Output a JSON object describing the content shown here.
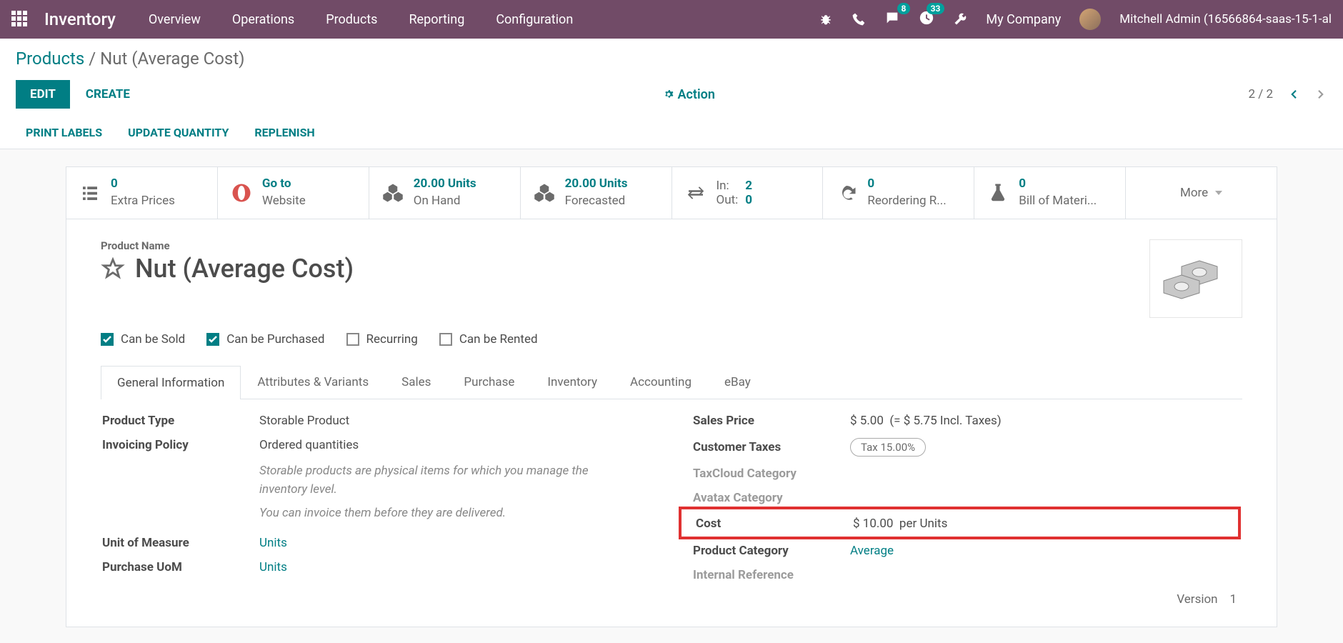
{
  "topnav": {
    "brand": "Inventory",
    "items": [
      "Overview",
      "Operations",
      "Products",
      "Reporting",
      "Configuration"
    ],
    "msg_badge": "8",
    "activity_badge": "33",
    "company": "My Company",
    "user": "Mitchell Admin (16566864-saas-15-1-al"
  },
  "breadcrumb": {
    "parent": "Products",
    "current": "Nut (Average Cost)"
  },
  "actions": {
    "edit": "EDIT",
    "create": "CREATE",
    "action": "Action",
    "pager": "2 / 2"
  },
  "subactions": [
    "PRINT LABELS",
    "UPDATE QUANTITY",
    "REPLENISH"
  ],
  "stats": {
    "extra_prices_n": "0",
    "extra_prices_l": "Extra Prices",
    "website_n": "Go to",
    "website_l": "Website",
    "onhand_n": "20.00 Units",
    "onhand_l": "On Hand",
    "forecast_n": "20.00 Units",
    "forecast_l": "Forecasted",
    "in_k": "In:",
    "in_v": "2",
    "out_k": "Out:",
    "out_v": "0",
    "reorder_n": "0",
    "reorder_l": "Reordering R...",
    "bom_n": "0",
    "bom_l": "Bill of Materi...",
    "more": "More"
  },
  "product": {
    "name_lbl": "Product Name",
    "name": "Nut (Average Cost)",
    "checks": {
      "sold": "Can be Sold",
      "purchased": "Can be Purchased",
      "recurring": "Recurring",
      "rented": "Can be Rented"
    }
  },
  "tabs": [
    "General Information",
    "Attributes & Variants",
    "Sales",
    "Purchase",
    "Inventory",
    "Accounting",
    "eBay"
  ],
  "gi": {
    "ptype_l": "Product Type",
    "ptype_v": "Storable Product",
    "inv_l": "Invoicing Policy",
    "inv_v": "Ordered quantities",
    "help1": "Storable products are physical items for which you manage the inventory level.",
    "help2": "You can invoice them before they are delivered.",
    "uom_l": "Unit of Measure",
    "uom_v": "Units",
    "puom_l": "Purchase UoM",
    "puom_v": "Units",
    "price_l": "Sales Price",
    "price_v": "$ 5.00",
    "price_incl": "(= $ 5.75 Incl. Taxes)",
    "tax_l": "Customer Taxes",
    "tax_v": "Tax 15.00%",
    "tcc_l": "TaxCloud Category",
    "ava_l": "Avatax Category",
    "cost_l": "Cost",
    "cost_v": "$ 10.00",
    "cost_per": "per Units",
    "cat_l": "Product Category",
    "cat_v": "Average",
    "ref_l": "Internal Reference",
    "version_l": "Version",
    "version_v": "1"
  }
}
